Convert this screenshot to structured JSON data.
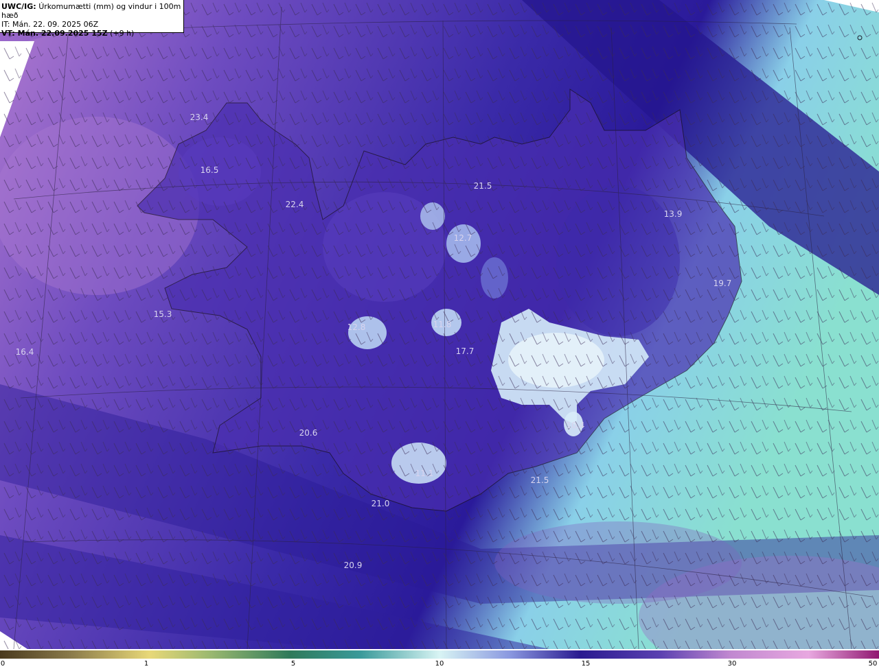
{
  "header": {
    "product": "UWC/IG:",
    "title": "Úrkomumætti (mm) og vindur i 100m hæð",
    "it_line": "IT: Mán. 22. 09. 2025 06Z",
    "vt_bold": "VT: Mán. 22.09.2025 15Z",
    "vt_suffix": "(+9 h)"
  },
  "values": [
    {
      "id": "v1",
      "text": "23.4"
    },
    {
      "id": "v2",
      "text": "16.5"
    },
    {
      "id": "v3",
      "text": "22.4"
    },
    {
      "id": "v4",
      "text": "21.5"
    },
    {
      "id": "v5",
      "text": "13.9"
    },
    {
      "id": "v6",
      "text": "12.7"
    },
    {
      "id": "v7",
      "text": "19.7"
    },
    {
      "id": "v8",
      "text": "15.3"
    },
    {
      "id": "v9",
      "text": "12.8"
    },
    {
      "id": "v10",
      "text": "11.8"
    },
    {
      "id": "v11",
      "text": "16.4"
    },
    {
      "id": "v12",
      "text": "17.7"
    },
    {
      "id": "v13",
      "text": "10.4"
    },
    {
      "id": "v14",
      "text": "20.6"
    },
    {
      "id": "v15",
      "text": "11.1"
    },
    {
      "id": "v16",
      "text": "21.5"
    },
    {
      "id": "v17",
      "text": "21.0"
    },
    {
      "id": "v18",
      "text": "20.9"
    }
  ],
  "colorbar": {
    "ticks": [
      "0",
      "1",
      "5",
      "10",
      "15",
      "30",
      "50"
    ],
    "colors": [
      "#4a3a1e",
      "#8a7a4a",
      "#c8b860",
      "#e8d878",
      "#8aa860",
      "#2f7a5a",
      "#1f6a6a",
      "#7ac8c0",
      "#d8f4f4",
      "#7a88d8",
      "#2a1a90",
      "#3a2a9a",
      "#7a5ab8",
      "#c088d0",
      "#e8a8e0",
      "#c040a0",
      "#901870"
    ]
  }
}
